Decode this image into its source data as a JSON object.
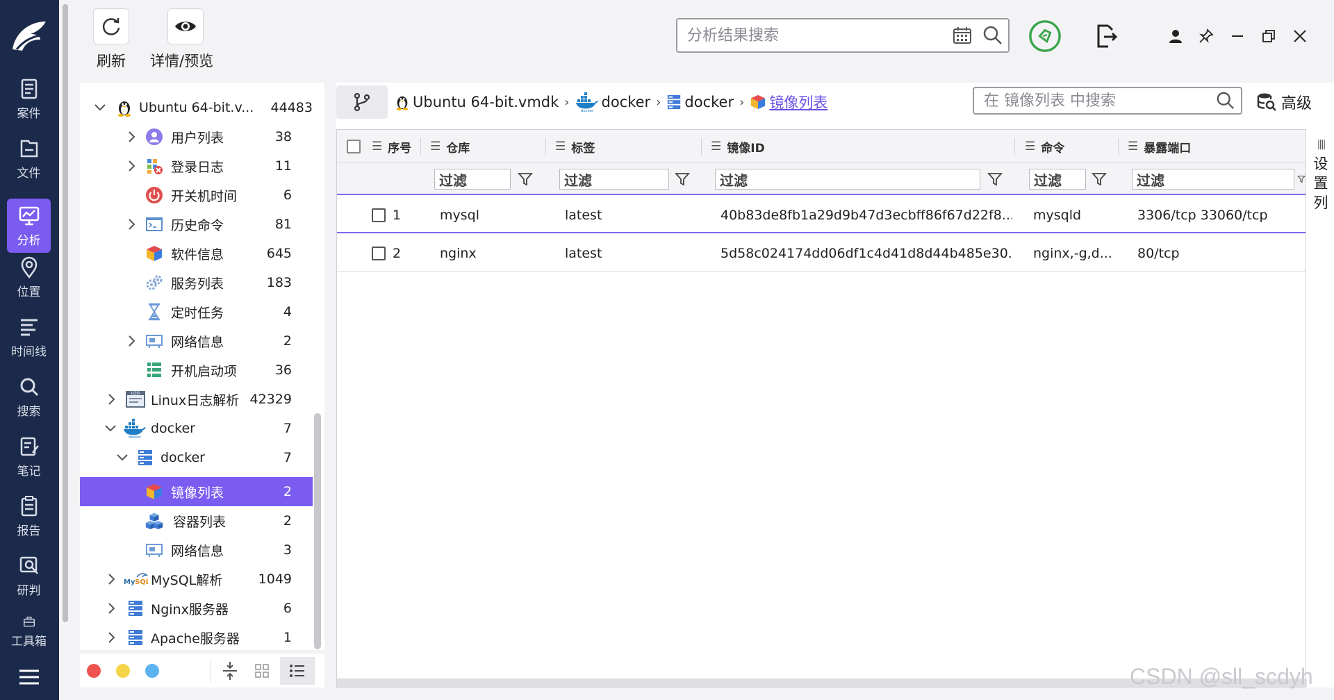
{
  "toolbar": {
    "refresh_label": "刷新",
    "details_label": "详情/预览"
  },
  "top_search": {
    "placeholder": "分析结果搜索"
  },
  "rail": {
    "items": [
      {
        "label": "案件",
        "icon": "case-icon"
      },
      {
        "label": "文件",
        "icon": "folder-icon"
      },
      {
        "label": "分析",
        "icon": "analysis-icon",
        "active": true
      },
      {
        "label": "位置",
        "icon": "location-icon"
      },
      {
        "label": "时间线",
        "icon": "timeline-icon"
      },
      {
        "label": "搜索",
        "icon": "search-icon"
      },
      {
        "label": "笔记",
        "icon": "notes-icon"
      },
      {
        "label": "报告",
        "icon": "report-icon"
      },
      {
        "label": "研判",
        "icon": "judge-icon"
      },
      {
        "label": "工具箱",
        "icon": "toolbox-icon"
      }
    ]
  },
  "tree": {
    "root": {
      "label": "Ubuntu 64-bit.v...",
      "count": "44483"
    },
    "items": [
      {
        "label": "用户列表",
        "count": "38"
      },
      {
        "label": "登录日志",
        "count": "11"
      },
      {
        "label": "开关机时间",
        "count": "6"
      },
      {
        "label": "历史命令",
        "count": "81"
      },
      {
        "label": "软件信息",
        "count": "645"
      },
      {
        "label": "服务列表",
        "count": "183"
      },
      {
        "label": "定时任务",
        "count": "4"
      },
      {
        "label": "网络信息",
        "count": "2"
      },
      {
        "label": "开机启动项",
        "count": "36"
      },
      {
        "label": "Linux日志解析",
        "count": "42329"
      },
      {
        "label": "docker",
        "count": "7"
      },
      {
        "label": "docker",
        "count": "7"
      },
      {
        "label": "镜像列表",
        "count": "2"
      },
      {
        "label": "容器列表",
        "count": "2"
      },
      {
        "label": "网络信息",
        "count": "3"
      },
      {
        "label": "MySQL解析",
        "count": "1049"
      },
      {
        "label": "Nginx服务器",
        "count": "6"
      },
      {
        "label": "Apache服务器",
        "count": "1"
      }
    ]
  },
  "breadcrumb": {
    "items": [
      "Ubuntu 64-bit.vmdk",
      "docker",
      "docker",
      "镜像列表"
    ]
  },
  "main_search": {
    "placeholder": "在 镜像列表 中搜索"
  },
  "advanced_label": "高级",
  "grid": {
    "columns": [
      "序号",
      "仓库",
      "标签",
      "镜像ID",
      "命令",
      "暴露端口"
    ],
    "filter_placeholder": "过滤",
    "rows": [
      {
        "index": "1",
        "repo": "mysql",
        "tag": "latest",
        "image_id": "40b83de8fb1a29d9b47d3ecbff86f67d22f8...",
        "command": "mysqld",
        "ports": "3306/tcp 33060/tcp"
      },
      {
        "index": "2",
        "repo": "nginx",
        "tag": "latest",
        "image_id": "5d58c024174dd06df1c4d41d8d44b485e30...",
        "command": "nginx,-g,d...",
        "ports": "80/tcp"
      }
    ]
  },
  "settings_col": [
    "设",
    "置",
    "列"
  ],
  "watermark": "CSDN @sll_scdyh",
  "colors": {
    "rail_bg": "#1b2a4a",
    "accent": "#7b5cf0",
    "shield_green": "#3aa54a"
  }
}
